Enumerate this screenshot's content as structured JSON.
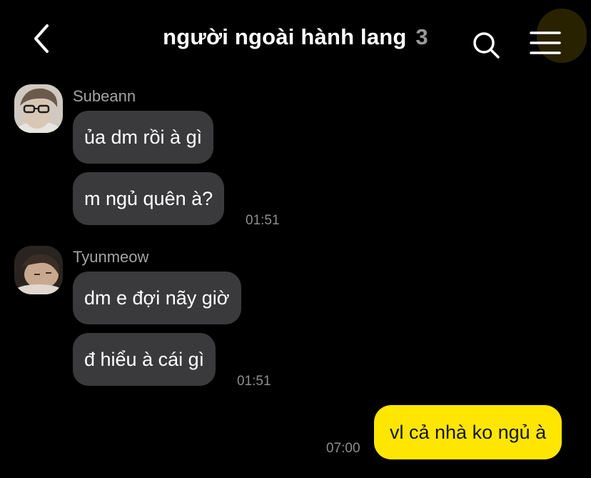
{
  "header": {
    "title": "người ngoài hành lang",
    "member_count": "3",
    "back_icon": "chevron-left-icon",
    "search_icon": "search-icon",
    "menu_icon": "hamburger-menu-icon"
  },
  "messages": [
    {
      "sender": "Subeann",
      "bubbles": [
        "ủa dm rồi à gì",
        "m ngủ quên à?"
      ],
      "time": "01:51"
    },
    {
      "sender": "Tyunmeow",
      "bubbles": [
        "dm e đợi nãy giờ",
        "đ hiểu à cái gì"
      ],
      "time": "01:51"
    }
  ],
  "my_message": {
    "text": "vl cả nhà ko ngủ à",
    "time": "07:00"
  },
  "colors": {
    "background": "#000000",
    "incoming_bubble": "#3a3a3c",
    "outgoing_bubble": "#ffe600",
    "secondary_text": "#a3a3a3"
  }
}
